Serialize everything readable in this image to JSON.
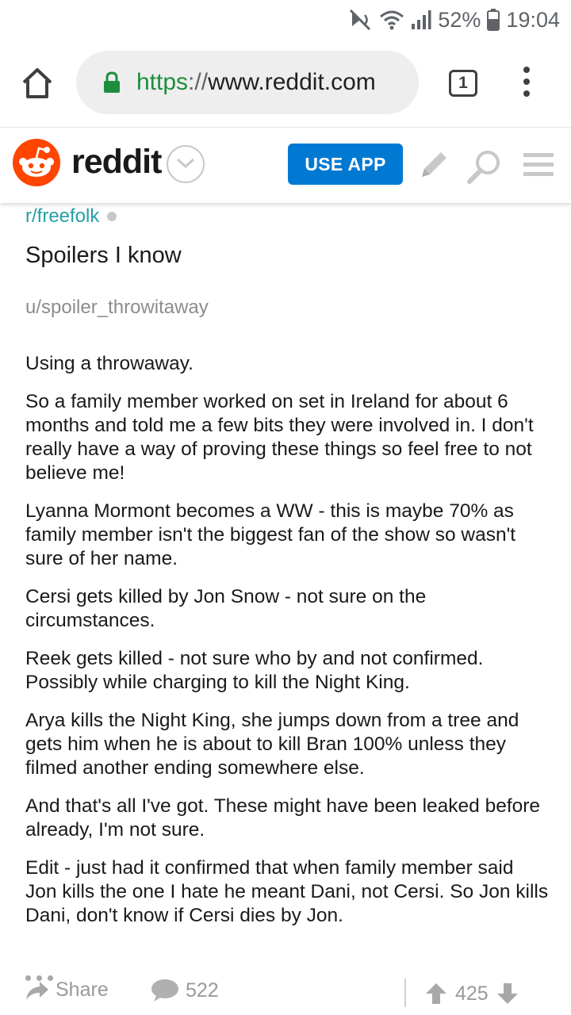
{
  "status_bar": {
    "battery": "52%",
    "time": "19:04"
  },
  "browser": {
    "url_scheme": "https",
    "url_separator": "://",
    "url_host": "www.reddit.com",
    "tab_count": "1"
  },
  "header": {
    "brand": "reddit",
    "use_app": "USE APP",
    "brand_color": "#ff4500",
    "button_color": "#0079d3"
  },
  "post": {
    "subreddit": "r/freefolk",
    "title": "Spoilers I know",
    "author": "u/spoiler_throwitaway",
    "paragraphs": [
      "Using a throwaway.",
      "So a family member worked on set in Ireland for about 6 months and told me a few bits they were involved in. I don't really have a way of proving these things so feel free to not believe me!",
      "Lyanna Mormont becomes a WW - this is maybe 70% as family member isn't the biggest fan of the show so wasn't sure of her name.",
      "Cersi gets killed by Jon Snow - not sure on the circumstances.",
      "Reek gets killed - not sure who by and not confirmed. Possibly while charging to kill the Night King.",
      "Arya kills the Night King, she jumps down from a tree and gets him when he is about to kill Bran 100% unless they filmed another ending somewhere else.",
      "And that's all I've got. These might have been leaked before already, I'm not sure.",
      "Edit - just had it confirmed that when family member said Jon kills the one I hate he meant Dani, not Cersi. So Jon kills Dani, don't know if Cersi dies by Jon."
    ]
  },
  "actions": {
    "share": "Share",
    "comments": "522",
    "score": "425"
  }
}
